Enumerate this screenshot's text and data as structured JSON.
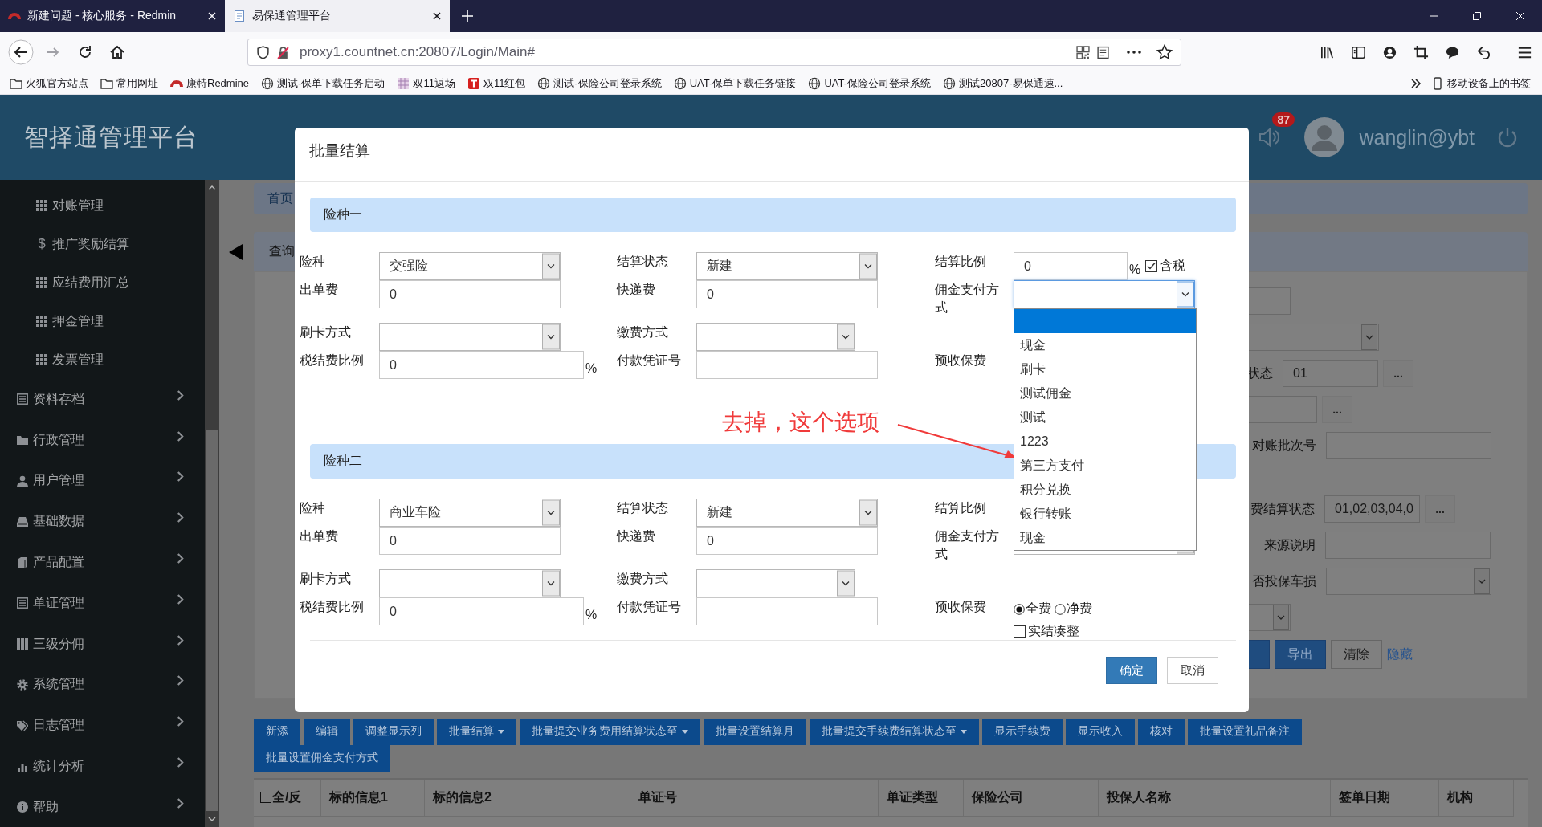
{
  "browser": {
    "tabs": [
      {
        "title": "新建问题 - 核心服务 - Redmin",
        "kind": "redmine",
        "selected": false
      },
      {
        "title": "易保通管理平台",
        "kind": "page",
        "selected": true
      }
    ],
    "url": "proxy1.countnet.cn:20807/Login/Main#",
    "bookmarks": [
      {
        "label": "火狐官方站点",
        "kind": "folder"
      },
      {
        "label": "常用网址",
        "kind": "folder"
      },
      {
        "label": "康特Redmine",
        "kind": "redmine"
      },
      {
        "label": "测试-保单下载任务启动",
        "kind": "globe"
      },
      {
        "label": "双11返场",
        "kind": "image"
      },
      {
        "label": "双11红包",
        "kind": "badge"
      },
      {
        "label": "测试-保险公司登录系统",
        "kind": "globe"
      },
      {
        "label": "UAT-保单下载任务链接",
        "kind": "globe"
      },
      {
        "label": "UAT-保险公司登录系统",
        "kind": "globe"
      },
      {
        "label": "测试20807-易保通速...",
        "kind": "globe"
      }
    ],
    "mobile_bookmarks": "移动设备上的书签"
  },
  "app": {
    "title": "智择通管理平台",
    "notification_count": "87",
    "user": "wanglin@ybt"
  },
  "sidebar": {
    "items": [
      {
        "label": "对账管理",
        "expandable": false,
        "kind": "grid"
      },
      {
        "label": "推广奖励结算",
        "expandable": false,
        "kind": "glyph",
        "glyph": "$"
      },
      {
        "label": "应结费用汇总",
        "expandable": false,
        "kind": "grid"
      },
      {
        "label": "押金管理",
        "expandable": false,
        "kind": "grid"
      },
      {
        "label": "发票管理",
        "expandable": false,
        "kind": "grid"
      },
      {
        "label": "资料存档",
        "expandable": true,
        "kind": "list"
      },
      {
        "label": "行政管理",
        "expandable": true,
        "kind": "folder"
      },
      {
        "label": "用户管理",
        "expandable": true,
        "kind": "user"
      },
      {
        "label": "基础数据",
        "expandable": true,
        "kind": "drive"
      },
      {
        "label": "产品配置",
        "expandable": true,
        "kind": "book"
      },
      {
        "label": "单证管理",
        "expandable": true,
        "kind": "list"
      },
      {
        "label": "三级分佣",
        "expandable": true,
        "kind": "grid"
      },
      {
        "label": "系统管理",
        "expandable": true,
        "kind": "gear"
      },
      {
        "label": "日志管理",
        "expandable": true,
        "kind": "tag"
      },
      {
        "label": "统计分析",
        "expandable": true,
        "kind": "chart"
      },
      {
        "label": "帮助",
        "expandable": true,
        "kind": "info"
      }
    ]
  },
  "background": {
    "breadcrumb": "首页",
    "panel_title": "查询",
    "form_rows": [
      {
        "field": {
          "kind": "input"
        }
      },
      {
        "field": {
          "kind": "select"
        }
      },
      {
        "label": "状态",
        "field": {
          "kind": "input",
          "value": "01"
        },
        "more": "..."
      },
      {
        "field": {
          "kind": "input"
        },
        "more": "..."
      },
      {
        "label": "对账批次号",
        "field": {
          "kind": "input"
        }
      },
      {
        "label": "费结算状态",
        "field": {
          "kind": "input",
          "value": "01,02,03,04,0"
        },
        "more": "..."
      },
      {
        "label": "来源说明",
        "field": {
          "kind": "input"
        }
      },
      {
        "label": "否投保车损",
        "field": {
          "kind": "select"
        }
      },
      {
        "field": {
          "kind": "select"
        }
      },
      {
        "buttons": [
          {
            "kind": "partial"
          },
          {
            "kind": "primary",
            "label": "导出"
          },
          {
            "kind": "default",
            "label": "清除"
          }
        ],
        "link": "隐藏"
      }
    ],
    "toolbar": [
      {
        "label": "新添",
        "dropdown": false
      },
      {
        "label": "编辑",
        "dropdown": false
      },
      {
        "label": "调整显示列",
        "dropdown": false
      },
      {
        "label": "批量结算",
        "dropdown": true
      },
      {
        "label": "批量提交业务费用结算状态至",
        "dropdown": true
      },
      {
        "label": "批量设置结算月",
        "dropdown": false
      },
      {
        "label": "批量提交手续费结算状态至",
        "dropdown": true
      },
      {
        "label": "显示手续费",
        "dropdown": false
      },
      {
        "label": "显示收入",
        "dropdown": false
      },
      {
        "label": "核对",
        "dropdown": false
      },
      {
        "label": "批量设置礼品备注",
        "dropdown": false
      },
      {
        "label": "批量设置佣金支付方式",
        "dropdown": false
      }
    ],
    "table_columns": [
      {
        "label": "全/反",
        "checkbox": true,
        "checked": false
      },
      {
        "label": "标的信息1"
      },
      {
        "label": "标的信息2"
      },
      {
        "label": "单证号"
      },
      {
        "label": "单证类型"
      },
      {
        "label": "保险公司"
      },
      {
        "label": "投保人名称"
      },
      {
        "label": "签单日期"
      },
      {
        "label": "机构"
      }
    ]
  },
  "modal": {
    "title": "批量结算",
    "sections": [
      {
        "header": "险种一",
        "columns": [
          [
            {
              "label": "险种",
              "kind": "select",
              "value": "交强险"
            },
            {
              "label": "出单费",
              "kind": "input",
              "value": "0"
            },
            {
              "label": "刷卡方式",
              "kind": "select"
            },
            {
              "label": "税结费比例",
              "kind": "input",
              "value": "0",
              "suffix": "%"
            }
          ],
          [
            {
              "label": "结算状态",
              "kind": "select",
              "value": "新建"
            },
            {
              "label": "快递费",
              "kind": "input",
              "value": "0"
            },
            {
              "label": "缴费方式",
              "kind": "select"
            },
            {
              "label": "付款凭证号",
              "kind": "input"
            }
          ],
          [
            {
              "label": "结算比例",
              "kind": "input",
              "value": "0",
              "suffix": "%",
              "checkbox": {
                "label": "含税",
                "checked": true
              }
            },
            {
              "label": "佣金支付方式",
              "kind": "select",
              "focused": true
            },
            {
              "label": "预收保费",
              "kind": "options"
            }
          ]
        ]
      },
      {
        "header": "险种二",
        "columns": [
          [
            {
              "label": "险种",
              "kind": "select",
              "value": "商业车险"
            },
            {
              "label": "出单费",
              "kind": "input",
              "value": "0"
            },
            {
              "label": "刷卡方式",
              "kind": "select"
            },
            {
              "label": "税结费比例",
              "kind": "input",
              "value": "0",
              "suffix": "%"
            }
          ],
          [
            {
              "label": "结算状态",
              "kind": "select",
              "value": "新建"
            },
            {
              "label": "快递费",
              "kind": "input",
              "value": "0"
            },
            {
              "label": "缴费方式",
              "kind": "select"
            },
            {
              "label": "付款凭证号",
              "kind": "input"
            }
          ],
          [
            {
              "label": "结算比例"
            },
            {
              "label": "佣金支付方式",
              "kind": "select"
            },
            {
              "label": "预收保费",
              "kind": "options",
              "radios": [
                {
                  "label": "全费",
                  "selected": true
                },
                {
                  "label": "净费",
                  "selected": false
                }
              ],
              "checkbox": {
                "label": "实结凑整",
                "checked": false
              }
            }
          ]
        ]
      }
    ],
    "dropdown": {
      "highlight_blank": true,
      "options": [
        {
          "label": "现金",
          "selected": false
        },
        {
          "label": "刷卡",
          "selected": false
        },
        {
          "label": "测试佣金",
          "selected": false
        },
        {
          "label": "测试",
          "selected": false
        },
        {
          "label": "1223",
          "selected": false
        },
        {
          "label": "第三方支付",
          "selected": false
        },
        {
          "label": "积分兑换",
          "selected": false
        },
        {
          "label": "银行转账",
          "selected": false
        },
        {
          "label": "现金",
          "selected": false
        }
      ]
    },
    "annotation": "去掉，这个选项",
    "buttons": [
      {
        "label": "确定",
        "kind": "primary"
      },
      {
        "label": "取消",
        "kind": "default"
      }
    ]
  }
}
